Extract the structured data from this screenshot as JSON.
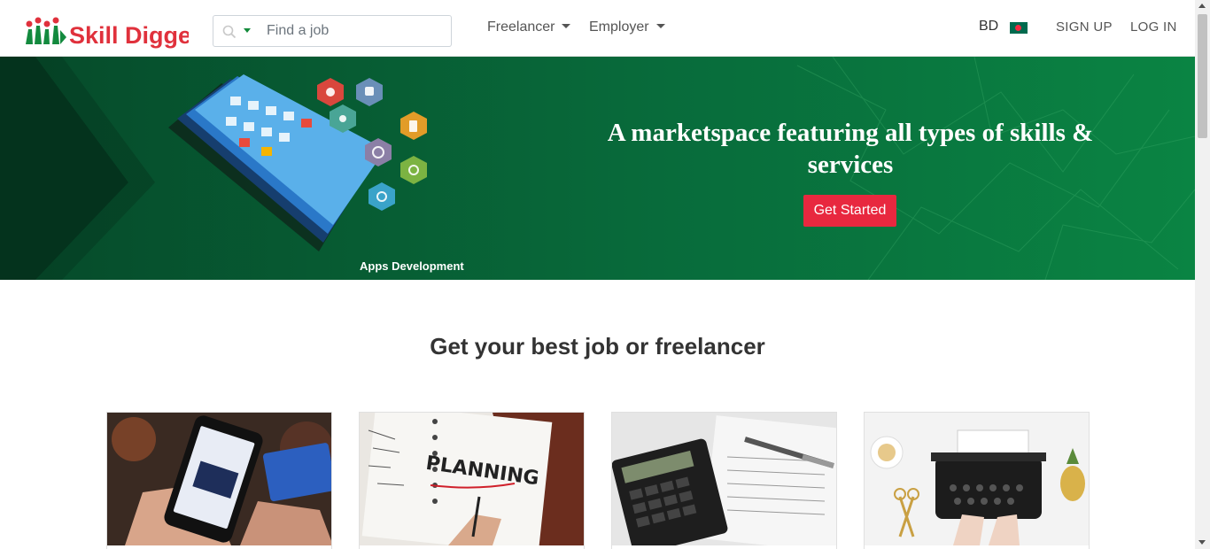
{
  "header": {
    "logo_text": "Skill Digger",
    "search": {
      "placeholder": "Find a job",
      "value": ""
    },
    "nav": [
      {
        "label": "Freelancer"
      },
      {
        "label": "Employer"
      }
    ],
    "country": "BD",
    "signup_label": "SIGN UP",
    "login_label": "LOG IN"
  },
  "hero": {
    "caption": "Apps Development",
    "title": "A marketspace featuring all types of skills & services",
    "cta_label": "Get Started"
  },
  "section": {
    "title": "Get your best job or freelancer"
  },
  "cards": [
    {
      "image": "phone-shopping-photo"
    },
    {
      "image": "planning-notebook-photo"
    },
    {
      "image": "calculator-photo"
    },
    {
      "image": "typewriter-photo"
    }
  ],
  "colors": {
    "brand_green": "#0a8443",
    "brand_red": "#e8283f",
    "hero_dark": "#064a2a"
  }
}
